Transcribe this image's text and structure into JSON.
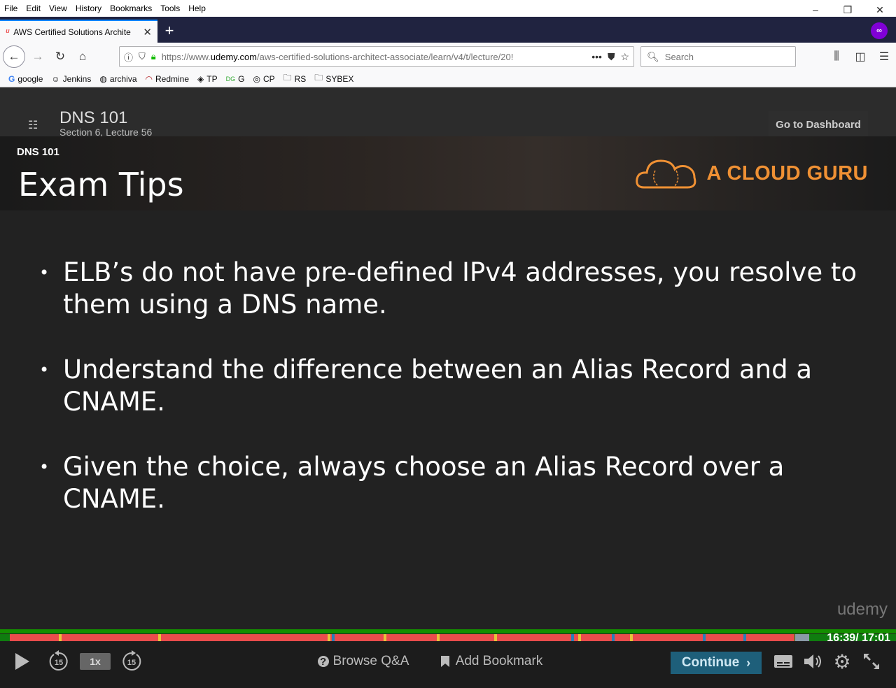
{
  "menubar": {
    "items": [
      "File",
      "Edit",
      "View",
      "History",
      "Bookmarks",
      "Tools",
      "Help"
    ]
  },
  "window_controls": {
    "minimize": "–",
    "restore": "❐",
    "close": "✕"
  },
  "tab": {
    "favicon": "udemy-icon",
    "title": "AWS Certified Solutions Archite",
    "close": "✕",
    "new_tab": "+"
  },
  "navbar": {
    "url_prefix": "https://www.",
    "url_domain": "udemy.com",
    "url_rest": "/aws-certified-solutions-architect-associate/learn/v4/t/lecture/20!",
    "search_placeholder": "Search",
    "page_actions": "•••"
  },
  "bookmarks": [
    {
      "label": "google",
      "icon": "google-icon"
    },
    {
      "label": "Jenkins",
      "icon": "jenkins-icon"
    },
    {
      "label": "archiva",
      "icon": "archiva-icon"
    },
    {
      "label": "Redmine",
      "icon": "redmine-icon"
    },
    {
      "label": "TP",
      "icon": "tp-icon"
    },
    {
      "label": "G",
      "icon": "g-icon"
    },
    {
      "label": "CP",
      "icon": "cp-icon"
    },
    {
      "label": "RS",
      "icon": "folder-icon"
    },
    {
      "label": "SYBEX",
      "icon": "folder-icon"
    }
  ],
  "player": {
    "lecture_title": "DNS 101",
    "lecture_subtitle": "Section 6, Lecture 56",
    "dashboard_button": "Go to Dashboard"
  },
  "slide": {
    "kicker": "DNS 101",
    "title": "Exam Tips",
    "brand": "A CLOUD GURU",
    "bullets": [
      "ELB’s do not have pre-defined IPv4 addresses, you resolve to them using a DNS name.",
      "Understand the difference between an Alias Record and a CNAME.",
      "Given the choice, always choose an Alias Record over a CNAME."
    ],
    "watermark": "udemy"
  },
  "progress": {
    "time": "16:39/ 17:01",
    "fraction": 0.978
  },
  "controls": {
    "rewind_seconds": "15",
    "speed": "1x",
    "forward_seconds": "15",
    "browse_qa": "Browse Q&A",
    "add_bookmark": "Add Bookmark",
    "continue": "Continue"
  },
  "colors": {
    "progress_fill": "#ea4c4c",
    "progress_track": "#148f00",
    "brand_orange": "#f09134",
    "continue_bg": "#1e5f7a"
  }
}
